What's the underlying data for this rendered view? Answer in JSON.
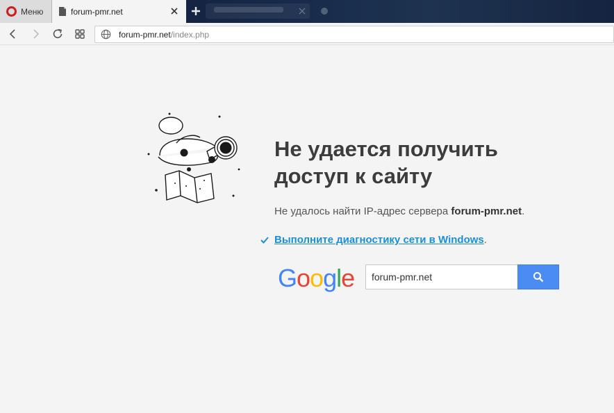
{
  "browser": {
    "menu_label": "Меню",
    "active_tab_title": "forum-pmr.net",
    "address": {
      "host": "forum-pmr.net",
      "path": "/index.php"
    }
  },
  "error": {
    "title": "Не удается получить доступ к сайту",
    "desc_prefix": "Не удалось найти IP-адрес сервера ",
    "desc_host": "forum-pmr.net",
    "desc_suffix": ".",
    "diag_link": "Выполните диагностику сети в Windows",
    "diag_suffix": "."
  },
  "google": {
    "logo_letters": [
      "G",
      "o",
      "o",
      "g",
      "l",
      "e"
    ],
    "logo_colors": [
      "#4285f4",
      "#ea4335",
      "#fbbc05",
      "#4285f4",
      "#34a853",
      "#ea4335"
    ],
    "search_value": "forum-pmr.net"
  },
  "colors": {
    "opera_red": "#d21b1b",
    "link_blue": "#1a8fd6",
    "search_button": "#4a8cf3"
  },
  "icons": {
    "back": "back-arrow-icon",
    "forward": "forward-arrow-icon",
    "reload": "reload-icon",
    "speed_dial": "grid-icon",
    "globe": "globe-icon",
    "check": "check-icon",
    "search": "magnifier-icon"
  }
}
